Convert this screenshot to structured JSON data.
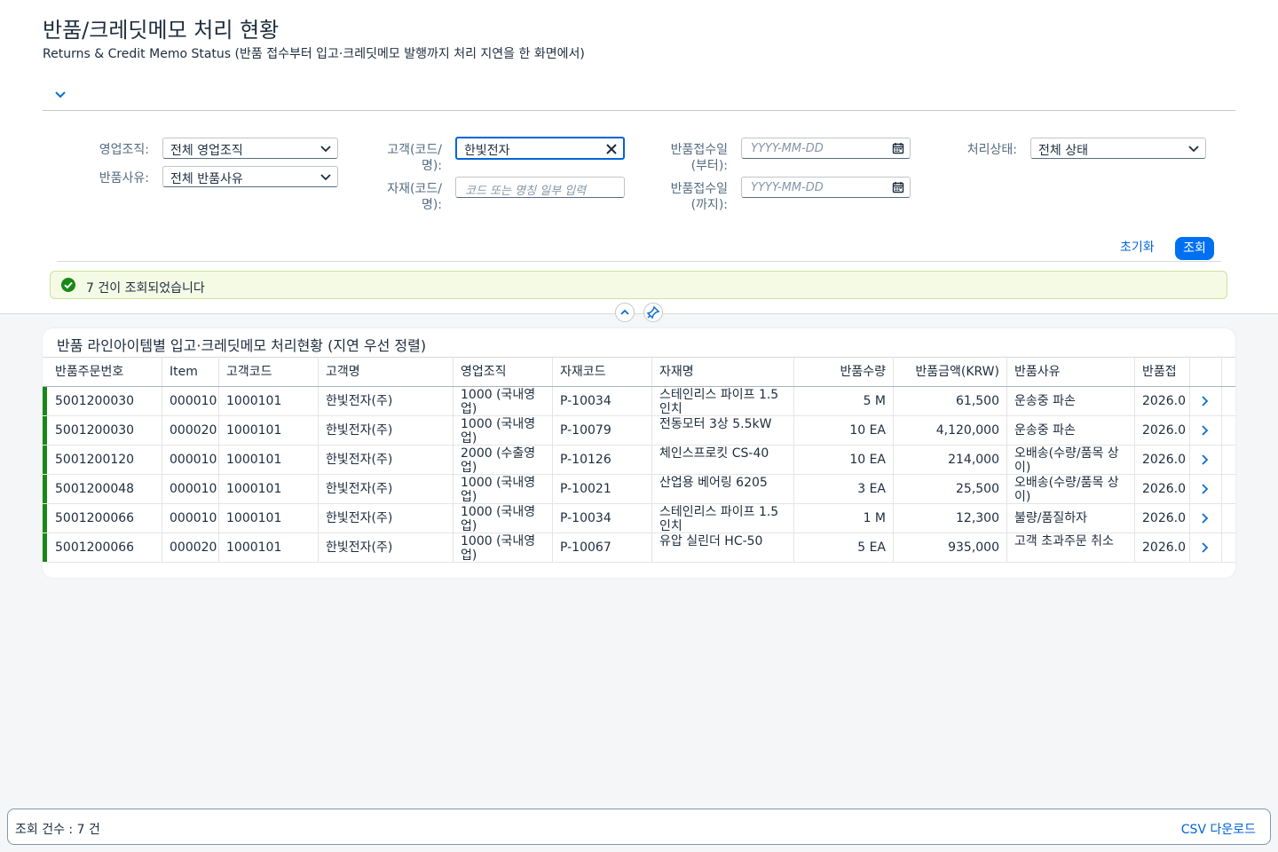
{
  "page": {
    "title": "반품/크레딧메모 처리 현황",
    "subtitle": "Returns & Credit Memo Status (반품 접수부터 입고·크레딧메모 발행까지 처리 지연을 한 화면에서)"
  },
  "filters": {
    "sales_org": {
      "label": "영업조직:",
      "value": "전체 영업조직"
    },
    "return_reason": {
      "label": "반품사유:",
      "value": "전체 반품사유"
    },
    "customer": {
      "label_line1": "고객(코드/",
      "label_line2": "명):",
      "value": "한빛전자"
    },
    "material": {
      "label_line1": "자재(코드/",
      "label_line2": "명):",
      "placeholder": "코드 또는 명칭 일부 입력"
    },
    "date_from": {
      "label_line1": "반품접수일",
      "label_line2": "(부터):",
      "placeholder": "YYYY-MM-DD"
    },
    "date_to": {
      "label_line1": "반품접수일",
      "label_line2": "(까지):",
      "placeholder": "YYYY-MM-DD"
    },
    "status": {
      "label": "처리상태:",
      "value": "전체 상태"
    },
    "reset_label": "초기화",
    "go_label": "조회"
  },
  "message": {
    "text": "7 건이 조회되었습니다",
    "color": "#188918"
  },
  "table": {
    "title": "반품 라인아이템별 입고·크레딧메모 처리현황 (지연 우선 정렬)",
    "columns": [
      "반품주문번호",
      "Item",
      "고객코드",
      "고객명",
      "영업조직",
      "자재코드",
      "자재명",
      "반품수량",
      "반품금액(KRW)",
      "반품사유",
      "반품접"
    ],
    "rows": [
      {
        "order": "5001200030",
        "item": "000010",
        "cust_code": "1000101",
        "cust_name": "한빛전자(주)",
        "org": "1000 (국내영업)",
        "mat_code": "P-10034",
        "mat_name": "스테인리스 파이프 1.5인치",
        "qty": "5 M",
        "amount": "61,500",
        "reason": "운송중 파손",
        "date": "2026.0"
      },
      {
        "order": "5001200030",
        "item": "000020",
        "cust_code": "1000101",
        "cust_name": "한빛전자(주)",
        "org": "1000 (국내영업)",
        "mat_code": "P-10079",
        "mat_name": "전동모터 3상 5.5kW",
        "qty": "10 EA",
        "amount": "4,120,000",
        "reason": "운송중 파손",
        "date": "2026.0"
      },
      {
        "order": "5001200120",
        "item": "000010",
        "cust_code": "1000101",
        "cust_name": "한빛전자(주)",
        "org": "2000 (수출영업)",
        "mat_code": "P-10126",
        "mat_name": "체인스프로킷 CS-40",
        "qty": "10 EA",
        "amount": "214,000",
        "reason": "오배송(수량/품목 상이)",
        "date": "2026.0"
      },
      {
        "order": "5001200048",
        "item": "000010",
        "cust_code": "1000101",
        "cust_name": "한빛전자(주)",
        "org": "1000 (국내영업)",
        "mat_code": "P-10021",
        "mat_name": "산업용 베어링 6205",
        "qty": "3 EA",
        "amount": "25,500",
        "reason": "오배송(수량/품목 상이)",
        "date": "2026.0"
      },
      {
        "order": "5001200066",
        "item": "000010",
        "cust_code": "1000101",
        "cust_name": "한빛전자(주)",
        "org": "1000 (국내영업)",
        "mat_code": "P-10034",
        "mat_name": "스테인리스 파이프 1.5인치",
        "qty": "1 M",
        "amount": "12,300",
        "reason": "불량/품질하자",
        "date": "2026.0"
      },
      {
        "order": "5001200066",
        "item": "000020",
        "cust_code": "1000101",
        "cust_name": "한빛전자(주)",
        "org": "1000 (국내영업)",
        "mat_code": "P-10067",
        "mat_name": "유압 실린더 HC-50",
        "qty": "5 EA",
        "amount": "935,000",
        "reason": "고객 초과주문 취소",
        "date": "2026.0"
      }
    ]
  },
  "footer": {
    "count_text": "조회 건수 : 7 건",
    "csv_label": "CSV 다운로드"
  },
  "colors": {
    "accent": "#0070f2",
    "status_green": "#188918",
    "message_bg": "#f5fae5"
  }
}
